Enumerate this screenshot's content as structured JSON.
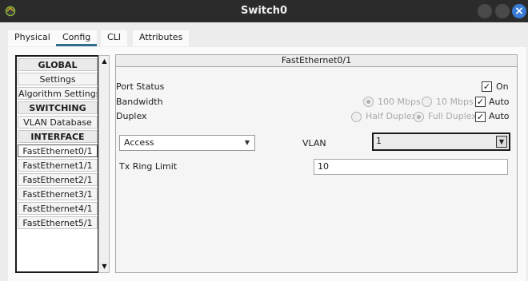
{
  "window": {
    "title": "Switch0",
    "close_glyph": "×"
  },
  "tabs": [
    {
      "label": "Physical",
      "active": false
    },
    {
      "label": "Config",
      "active": true
    },
    {
      "label": "CLI",
      "active": false
    },
    {
      "label": "Attributes",
      "active": false
    }
  ],
  "sidebar": {
    "items": [
      {
        "label": "GLOBAL",
        "header": true
      },
      {
        "label": "Settings"
      },
      {
        "label": "Algorithm Settings"
      },
      {
        "label": "SWITCHING",
        "header": true
      },
      {
        "label": "VLAN Database"
      },
      {
        "label": "INTERFACE",
        "header": true
      },
      {
        "label": "FastEthernet0/1",
        "selected": true
      },
      {
        "label": "FastEthernet1/1"
      },
      {
        "label": "FastEthernet2/1"
      },
      {
        "label": "FastEthernet3/1"
      },
      {
        "label": "FastEthernet4/1"
      },
      {
        "label": "FastEthernet5/1"
      }
    ],
    "scroll_up": "▲",
    "scroll_down": "▼"
  },
  "panel": {
    "title": "FastEthernet0/1",
    "port_status": {
      "label": "Port Status",
      "on_label": "On",
      "on_checked": true
    },
    "bandwidth": {
      "label": "Bandwidth",
      "options": [
        "100 Mbps",
        "10 Mbps"
      ],
      "selected": "100 Mbps",
      "auto_label": "Auto",
      "auto_checked": true
    },
    "duplex": {
      "label": "Duplex",
      "options": [
        "Half Duplex",
        "Full Duplex"
      ],
      "selected": "Full Duplex",
      "auto_label": "Auto",
      "auto_checked": true
    },
    "mode": {
      "value": "Access"
    },
    "vlan": {
      "label": "VLAN",
      "value": "1"
    },
    "tx_ring": {
      "label": "Tx Ring Limit",
      "value": "10"
    },
    "check_glyph": "✓",
    "dropdown_glyph": "▼"
  },
  "colors": {
    "titlebar": "#2b2b2b",
    "close_button": "#3a7bd5",
    "tab_underline": "#2f6c8f"
  }
}
